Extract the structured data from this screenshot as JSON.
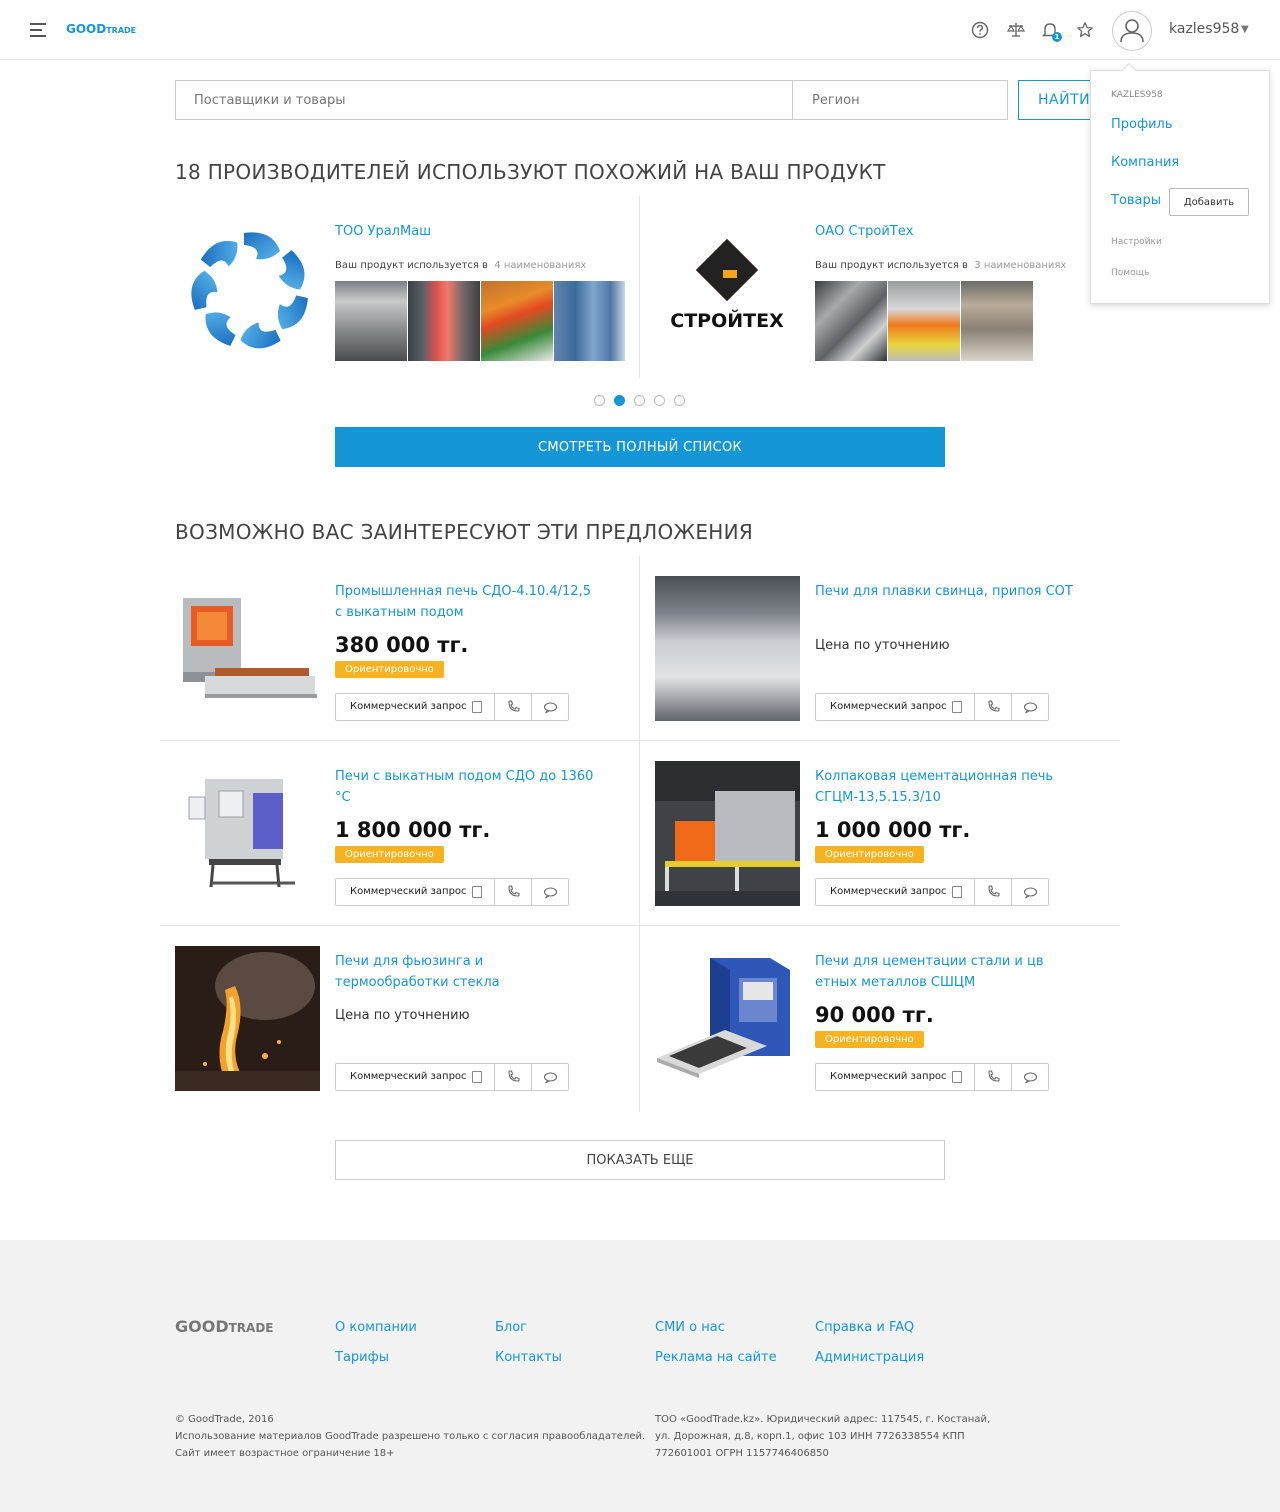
{
  "header": {
    "logo_main": "GOOD",
    "logo_sub": "TRADE",
    "notifications_count": "1",
    "username": "kazles958"
  },
  "search": {
    "query_placeholder": "Поставщики и товары",
    "region_placeholder": "Регион",
    "button_label": "НАЙТИ"
  },
  "user_menu": {
    "username_upper": "KAZLES958",
    "profile": "Профиль",
    "company": "Компания",
    "products": "Товары",
    "add": "Добавить",
    "settings": "Настройки",
    "help": "Помощь"
  },
  "manufacturers": {
    "title": "18 ПРОИЗВОДИТЕЛЕЙ ИСПОЛЬЗУЮТ ПОХОЖИЙ НА ВАШ ПРОДУКТ",
    "items": [
      {
        "name": "ТОО УралМаш",
        "used_label": "Ваш продукт используется в",
        "count_label": "4 наименованиях"
      },
      {
        "name": "ОАО СтройТех",
        "logo_text": "СТРОЙТЕХ",
        "used_label": "Ваш продукт используется в",
        "count_label": "3 наименованиях"
      }
    ],
    "carousel_active_index": 1,
    "carousel_pages": 5,
    "full_list_button": "СМОТРЕТЬ ПОЛНЫЙ СПИСОК"
  },
  "offers": {
    "title": "ВОЗМОЖНО ВАС ЗАИНТЕРЕСУЮТ ЭТИ ПРЕДЛОЖЕНИЯ",
    "request_label": "Коммерческий запрос",
    "estimate_label": "Ориентировочно",
    "items": [
      {
        "title": "Промышленная печь СДО-4.10.4/12,5 с выкатным подом",
        "price": "380 000 тг."
      },
      {
        "title": "Печи для плавки свинца, припоя СОТ",
        "price_text": "Цена по уточнению"
      },
      {
        "title": "Печи с выкатным подом СДО до 1360 °C",
        "price": "1 800 000 тг."
      },
      {
        "title": "Колпаковая цементационная печь СГЦМ-13,5.15.3/10",
        "price": "1 000 000 тг."
      },
      {
        "title": "Печи для фьюзинга и термообработки стекла",
        "price_text": "Цена по уточнению"
      },
      {
        "title": "Печи для цементации стали и цв етных металлов СШЦМ",
        "price": "90 000 тг."
      }
    ],
    "show_more": "ПОКАЗАТЬ ЕЩЕ"
  },
  "footer": {
    "logo_main": "GOOD",
    "logo_sub": "TRADE",
    "links": [
      "О компании",
      "Блог",
      "СМИ о нас",
      "Справка и FAQ",
      "Тарифы",
      "Контакты",
      "Реклама на сайте",
      "Администрация"
    ],
    "copyright": "© GoodTrade, 2016",
    "usage": "Использование материалов GoodTrade разрешено только с согласия правообладателей.",
    "age": "Сайт имеет возрастное ограничение 18+",
    "legal_1": "ТОО «GoodTrade.kz». Юридический адрес: 117545, г. Костанай,",
    "legal_2": "ул. Дорожная, д.8, корп.1, офис 103 ИНН 7726338554 КПП",
    "legal_3": "772601001 ОГРН 1157746406850"
  },
  "colors": {
    "accent": "#1596d6",
    "badge": "#f7b221",
    "footer_bg": "#f2f2f2"
  },
  "icons": [
    "menu-icon",
    "help-icon",
    "compare-icon",
    "bell-icon",
    "star-icon",
    "user-icon",
    "document-icon",
    "phone-icon",
    "chat-icon"
  ]
}
